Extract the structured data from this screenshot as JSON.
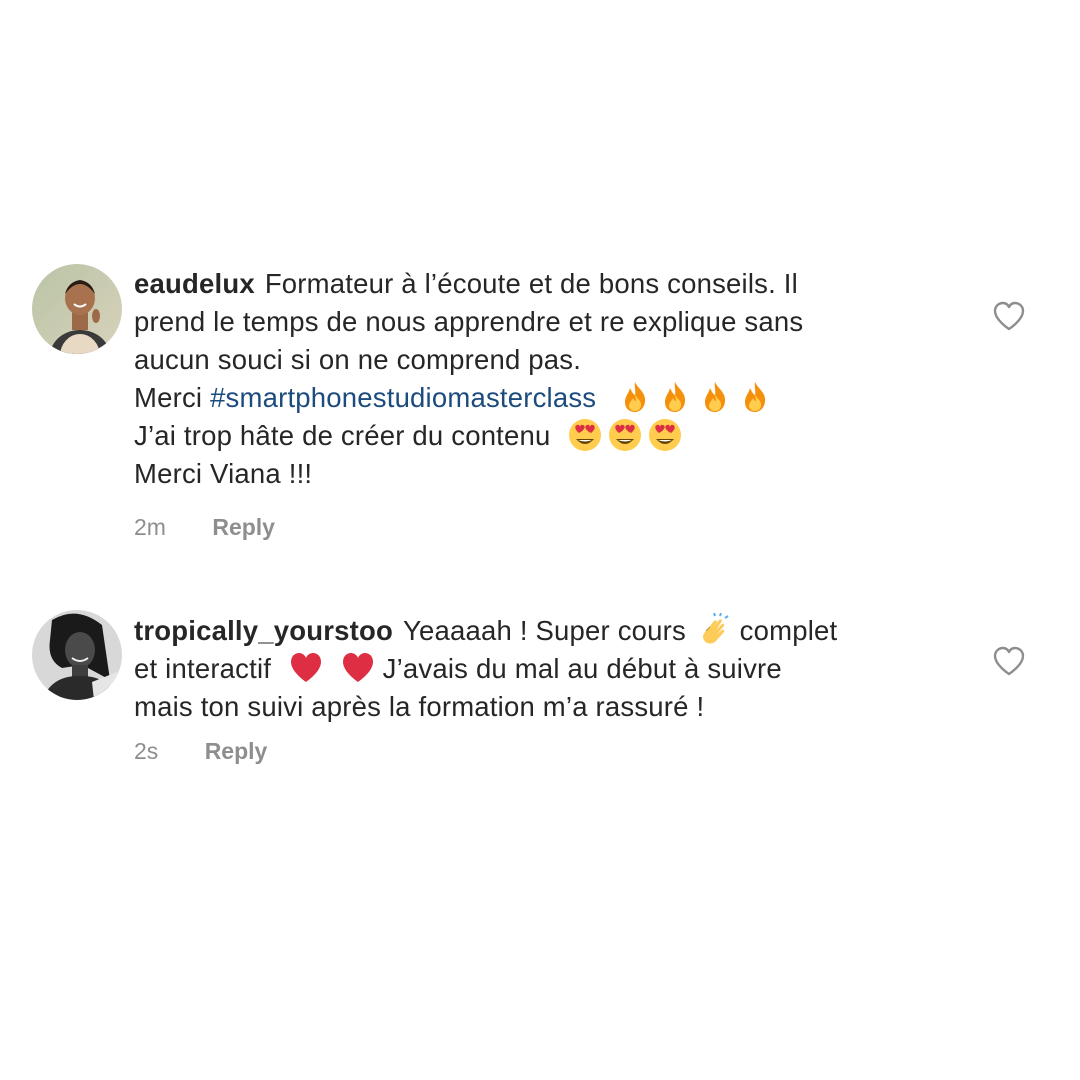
{
  "comments": [
    {
      "username": "eaudelux",
      "lines": [
        "Formateur à l’écoute et de bons conseils. Il",
        "prend le temps de nous apprendre et re explique sans",
        "aucun souci si on ne comprend pas."
      ],
      "merci_prefix": "Merci ",
      "hashtag": "#smartphonestudiomasterclass",
      "line5": "J’ai trop hâte de créer du contenu",
      "line6": "Merci Viana !!!",
      "time": "2m",
      "reply": "Reply",
      "icons": {
        "avatar": "profile-photo-avatar",
        "fire": "fire-emoji",
        "heart_eyes": "heart-eyes-emoji",
        "like": "heart-outline-icon"
      }
    },
    {
      "username": "tropically_yourstoo",
      "line1": "Yeaaaah ! Super cours",
      "line1_end": "complet",
      "line2_start": "et interactif",
      "line2_end": "J’avais du mal au début à suivre",
      "line3": "mais ton suivi après la formation m’a rassuré !",
      "time": "2s",
      "reply": "Reply",
      "icons": {
        "avatar": "profile-photo-avatar",
        "clap": "clapping-hands-emoji",
        "red_heart": "red-heart-emoji",
        "like": "heart-outline-icon"
      }
    }
  ],
  "colors": {
    "text": "#262626",
    "hashtag": "#1c4b7d",
    "meta": "#8e8e8e",
    "like_icon": "#8e8e8e"
  }
}
